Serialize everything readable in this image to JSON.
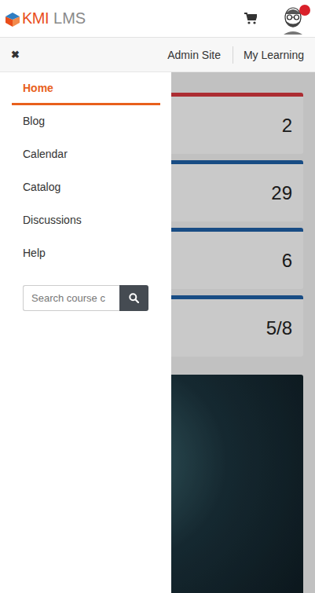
{
  "header": {
    "logo": {
      "brand": "KMI",
      "product": "LMS"
    },
    "notification": true
  },
  "toolbar": {
    "close": "✖",
    "links": [
      "Admin Site",
      "My Learning"
    ]
  },
  "menu": {
    "items": [
      {
        "label": "Home",
        "selected": true
      },
      {
        "label": "Blog",
        "selected": false
      },
      {
        "label": "Calendar",
        "selected": false
      },
      {
        "label": "Catalog",
        "selected": false
      },
      {
        "label": "Discussions",
        "selected": false
      },
      {
        "label": "Help",
        "selected": false
      }
    ]
  },
  "search": {
    "placeholder": "Search course c"
  },
  "cards": [
    {
      "value": "2",
      "color": "#d8393f"
    },
    {
      "value": "29",
      "color": "#1f5fa6"
    },
    {
      "value": "6",
      "color": "#1f5fa6"
    },
    {
      "value": "5/8",
      "color": "#1f5fa6"
    }
  ]
}
